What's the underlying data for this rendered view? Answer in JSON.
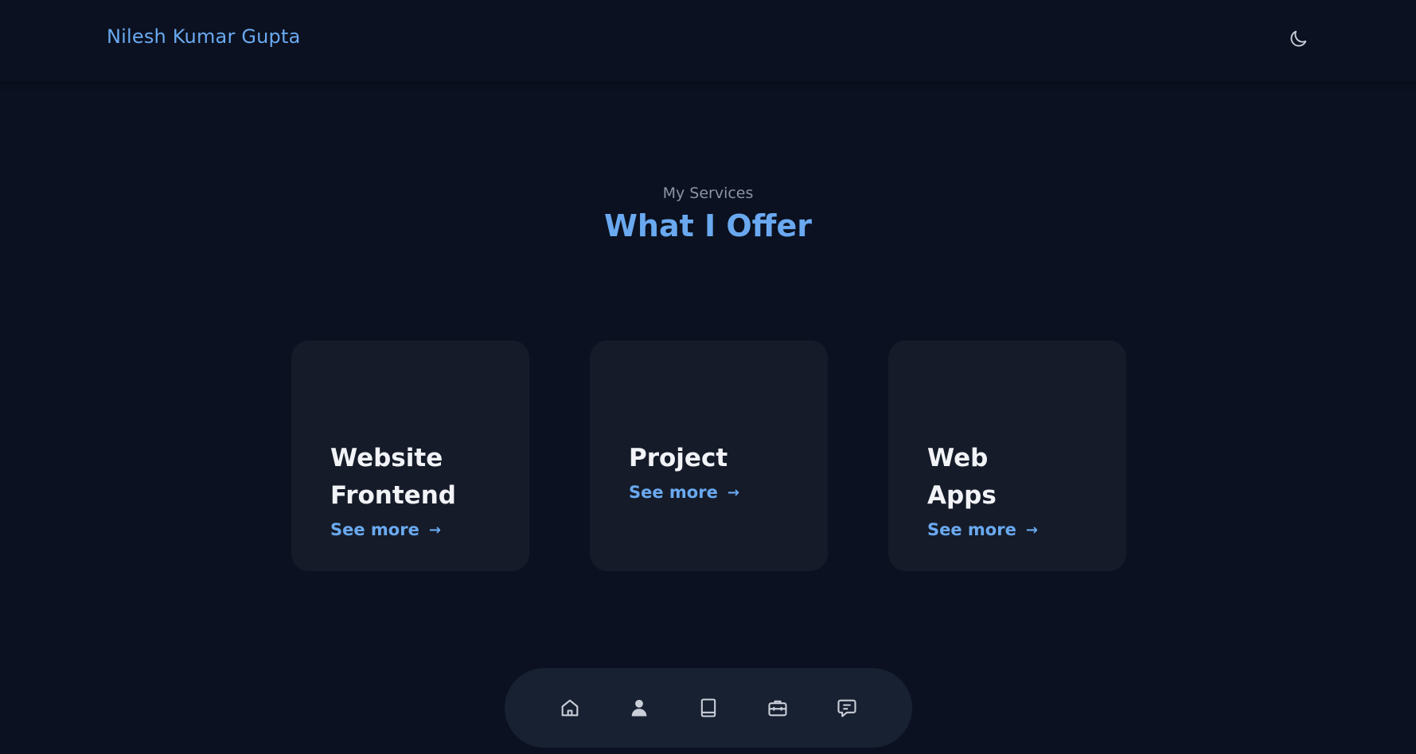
{
  "header": {
    "logo": "Nilesh Kumar Gupta",
    "theme_toggle_icon": "moon-icon"
  },
  "services": {
    "subtitle": "My Services",
    "title": "What I Offer",
    "cards": [
      {
        "title": "Website Frontend",
        "link": "See more",
        "link_icon": "arrow-right-icon"
      },
      {
        "title": "Project",
        "link": "See more",
        "link_icon": "arrow-right-icon"
      },
      {
        "title": "Web Apps",
        "link": "See more",
        "link_icon": "arrow-right-icon"
      }
    ]
  },
  "bottom_nav": {
    "items": [
      {
        "icon": "home-icon"
      },
      {
        "icon": "user-icon"
      },
      {
        "icon": "book-icon"
      },
      {
        "icon": "briefcase-icon"
      },
      {
        "icon": "message-icon"
      }
    ]
  },
  "colors": {
    "background": "#0b1120",
    "card": "#151b28",
    "accent": "#6aa9f0",
    "nav": "#182132",
    "text": "#f1f3f7",
    "muted": "#8a94a6"
  }
}
